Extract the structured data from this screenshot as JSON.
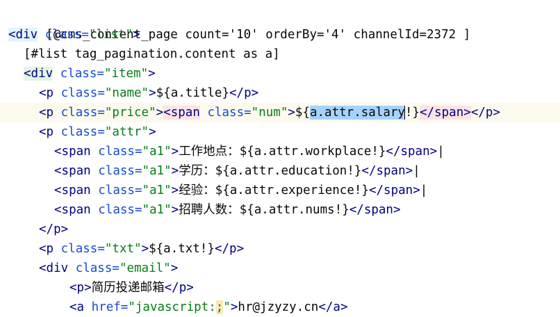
{
  "code_lines": [
    {
      "text_1": "[@cms_content_page count='10' orderBy='4' channelId=2372 ]"
    },
    {
      "open": "<",
      "tag": "div",
      "attr": "class",
      "eq": "=",
      "val": "\"list\"",
      "close": ">"
    },
    {
      "text_1": "[#list tag_pagination.content as a]"
    },
    {
      "open": "<",
      "tag": "div",
      "attr": "class",
      "eq": "=",
      "val": "\"item\"",
      "close": ">"
    },
    {
      "open": "<",
      "tag": "p",
      "attr": "class",
      "eq": "=",
      "val": "\"name\"",
      "close": ">",
      "content": "${a.title}",
      "end_open": "</",
      "end_tag": "p",
      "end_close": ">"
    },
    {
      "open": "<",
      "tag": "p",
      "attr": "class",
      "eq": "=",
      "val": "\"price\"",
      "close": ">",
      "span_open": "<",
      "span_tag": "span",
      "span_attr": "class",
      "span_eq": "=",
      "span_val": "\"num\"",
      "span_close": ">",
      "pre": "${",
      "selected": "a.attr.salary",
      "post": "!}",
      "span_end_open": "</",
      "span_end_tag": "span",
      "span_end_close": ">",
      "end_open": "</",
      "end_tag": "p",
      "end_close": ">"
    },
    {
      "open": "<",
      "tag": "p",
      "attr": "class",
      "eq": "=",
      "val": "\"attr\"",
      "close": ">"
    },
    {
      "open": "<",
      "tag": "span",
      "attr": "class",
      "eq": "=",
      "val": "\"a1\"",
      "close": ">",
      "label": "工作地点：",
      "content": "${a.attr.workplace!}",
      "end_open": "</",
      "end_tag": "span",
      "end_close": ">",
      "tail": "|"
    },
    {
      "open": "<",
      "tag": "span",
      "attr": "class",
      "eq": "=",
      "val": "\"a1\"",
      "close": ">",
      "label": "学历：",
      "content": "${a.attr.education!}",
      "end_open": "</",
      "end_tag": "span",
      "end_close": ">",
      "tail": "|"
    },
    {
      "open": "<",
      "tag": "span",
      "attr": "class",
      "eq": "=",
      "val": "\"a1\"",
      "close": ">",
      "label": "经验：",
      "content": "${a.attr.experience!}",
      "end_open": "</",
      "end_tag": "span",
      "end_close": ">",
      "tail": "|"
    },
    {
      "open": "<",
      "tag": "span",
      "attr": "class",
      "eq": "=",
      "val": "\"a1\"",
      "close": ">",
      "label": "招聘人数：",
      "content": "${a.attr.nums!}",
      "end_open": "</",
      "end_tag": "span",
      "end_close": ">"
    },
    {
      "end_open": "</",
      "end_tag": "p",
      "end_close": ">"
    },
    {
      "open": "<",
      "tag": "p",
      "attr": "class",
      "eq": "=",
      "val": "\"txt\"",
      "close": ">",
      "content": "${a.txt!}",
      "end_open": "</",
      "end_tag": "p",
      "end_close": ">"
    },
    {
      "open": "<",
      "tag": "div",
      "attr": "class",
      "eq": "=",
      "val": "\"email\"",
      "close": ">"
    },
    {
      "open": "<",
      "tag": "p",
      "close": ">",
      "label": "简历投递邮箱",
      "end_open": "</",
      "end_tag": "p",
      "end_close": ">"
    },
    {
      "open": "<",
      "tag": "a",
      "attr": "href",
      "eq": "=",
      "val_1": "\"javascript:",
      "val_sq": ";",
      "val_2": "\"",
      "close": ">",
      "content": "hr@jzyzy.cn",
      "end_open": "</",
      "end_tag": "a",
      "end_close": ">"
    }
  ]
}
